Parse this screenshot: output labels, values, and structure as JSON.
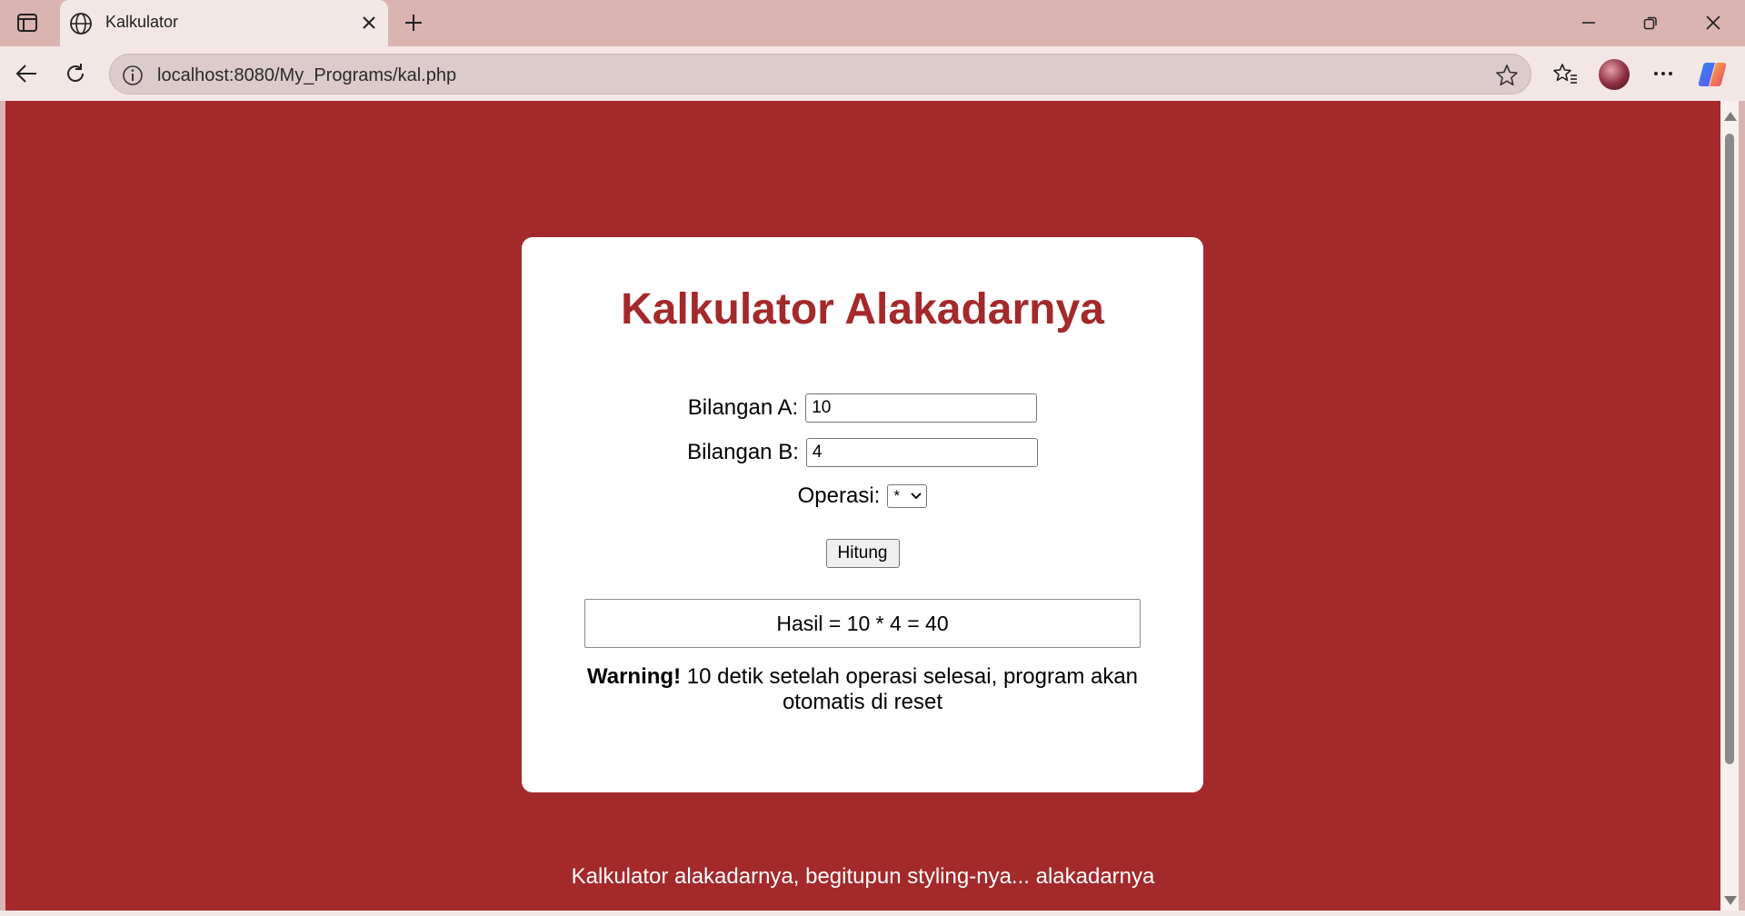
{
  "browser": {
    "tab_title": "Kalkulator",
    "url": "localhost:8080/My_Programs/kal.php",
    "icons": [
      "tab-actions-icon",
      "globe-icon",
      "close-icon",
      "plus-icon",
      "minimize-icon",
      "restore-icon",
      "close-window-icon",
      "back-icon",
      "refresh-icon",
      "info-icon",
      "star-icon",
      "favorites-icon",
      "more-icon",
      "copilot-icon"
    ]
  },
  "page": {
    "background_color": "#a4292b",
    "title": "Kalkulator Alakadarnya",
    "title_color": "#a4292b",
    "field_a": {
      "label": "Bilangan A:",
      "value": "10"
    },
    "field_b": {
      "label": "Bilangan B:",
      "value": "4"
    },
    "operation": {
      "label": "Operasi:",
      "selected": "*"
    },
    "submit_label": "Hitung",
    "result": "Hasil = 10 * 4 = 40",
    "warning": {
      "strong": "Warning!",
      "line1": " 10 detik setelah operasi selesai, program akan",
      "line2": "otomatis di reset"
    },
    "footer": "Kalkulator alakadarnya, begitupun styling-nya... alakadarnya"
  }
}
